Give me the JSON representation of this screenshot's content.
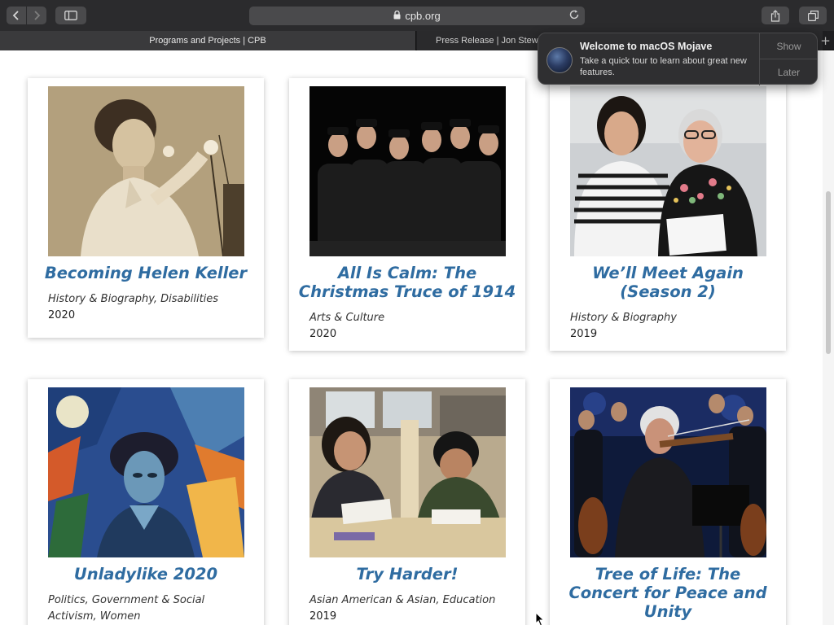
{
  "browser": {
    "url": "cpb.org",
    "tabs": [
      {
        "label": "Programs and Projects | CPB"
      },
      {
        "label": "Press Release | Jon Stewart..."
      }
    ]
  },
  "notification": {
    "title": "Welcome to macOS Mojave",
    "body": "Take a quick tour to learn about great new features.",
    "show_label": "Show",
    "later_label": "Later"
  },
  "cards": [
    {
      "title": "Becoming Helen Keller",
      "categories": "History & Biography, Disabilities",
      "year": "2020"
    },
    {
      "title": "All Is Calm: The Christmas Truce of 1914",
      "categories": "Arts & Culture",
      "year": "2020"
    },
    {
      "title": "We’ll Meet Again (Season 2)",
      "categories": "History & Biography",
      "year": "2019"
    },
    {
      "title": "Unladylike 2020",
      "categories": "Politics, Government & Social Activism, Women",
      "year": ""
    },
    {
      "title": "Try Harder!",
      "categories": "Asian American & Asian, Education",
      "year": "2019"
    },
    {
      "title": "Tree of Life: The Concert for Peace and Unity",
      "categories": "",
      "year": ""
    }
  ],
  "colors": {
    "title_link": "#2f6ca1",
    "toolbar": "#2b2b2d"
  }
}
